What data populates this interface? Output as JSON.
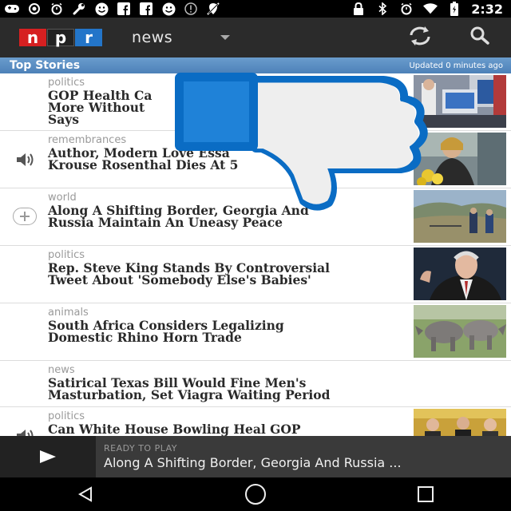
{
  "status_bar": {
    "time": "2:32",
    "left_icons": [
      "gamepad-icon",
      "location-icon",
      "alarm-icon",
      "wrench-icon",
      "smiley-icon",
      "facebook-icon",
      "facebook-icon",
      "smiley-icon",
      "info-icon",
      "blocked-location-icon"
    ],
    "right_icons": [
      "lock-icon",
      "bluetooth-icon",
      "alarm-icon",
      "wifi-icon",
      "battery-icon"
    ]
  },
  "app_bar": {
    "logo_letters": [
      "n",
      "p",
      "r"
    ],
    "section": "news",
    "refresh_icon": "refresh-icon",
    "search_icon": "search-icon"
  },
  "header": {
    "title": "Top Stories",
    "updated": "Updated 0 minutes ago"
  },
  "stories": [
    {
      "category": "politics",
      "title": "GOP Health Ca\nMore Without\nSays",
      "lead": "",
      "thumb": "press-conference"
    },
    {
      "category": "remembrances",
      "title": "Author, Modern Love Essa\nKrouse Rosenthal Dies At 5",
      "lead": "speaker-icon",
      "thumb": "author-portrait"
    },
    {
      "category": "world",
      "title": "Along A Shifting Border, Georgia And\nRussia Maintain An Uneasy Peace",
      "lead": "plus-icon",
      "thumb": "border-landscape"
    },
    {
      "category": "politics",
      "title": "Rep. Steve King Stands By Controversial\nTweet About 'Somebody Else's Babies'",
      "lead": "",
      "thumb": "politician"
    },
    {
      "category": "animals",
      "title": "South Africa Considers Legalizing\nDomestic Rhino Horn Trade",
      "lead": "",
      "thumb": "rhinos"
    },
    {
      "category": "news",
      "title": "Satirical Texas Bill Would Fine Men's\nMasturbation, Set Viagra Waiting Period",
      "lead": "",
      "thumb": ""
    },
    {
      "category": "politics",
      "title": "Can White House Bowling Heal GOP",
      "lead": "speaker-icon",
      "thumb": "white-house"
    }
  ],
  "player": {
    "status": "READY TO PLAY",
    "title": "Along A Shifting Border, Georgia And Russia ..."
  },
  "nav": {
    "back": "back-icon",
    "home": "home-icon",
    "recents": "recents-icon"
  },
  "colors": {
    "npr_red": "#d62021",
    "npr_blue": "#2375c9",
    "header_blue": "#5a8ec4",
    "thumb_blue": "#0a6cc4"
  }
}
